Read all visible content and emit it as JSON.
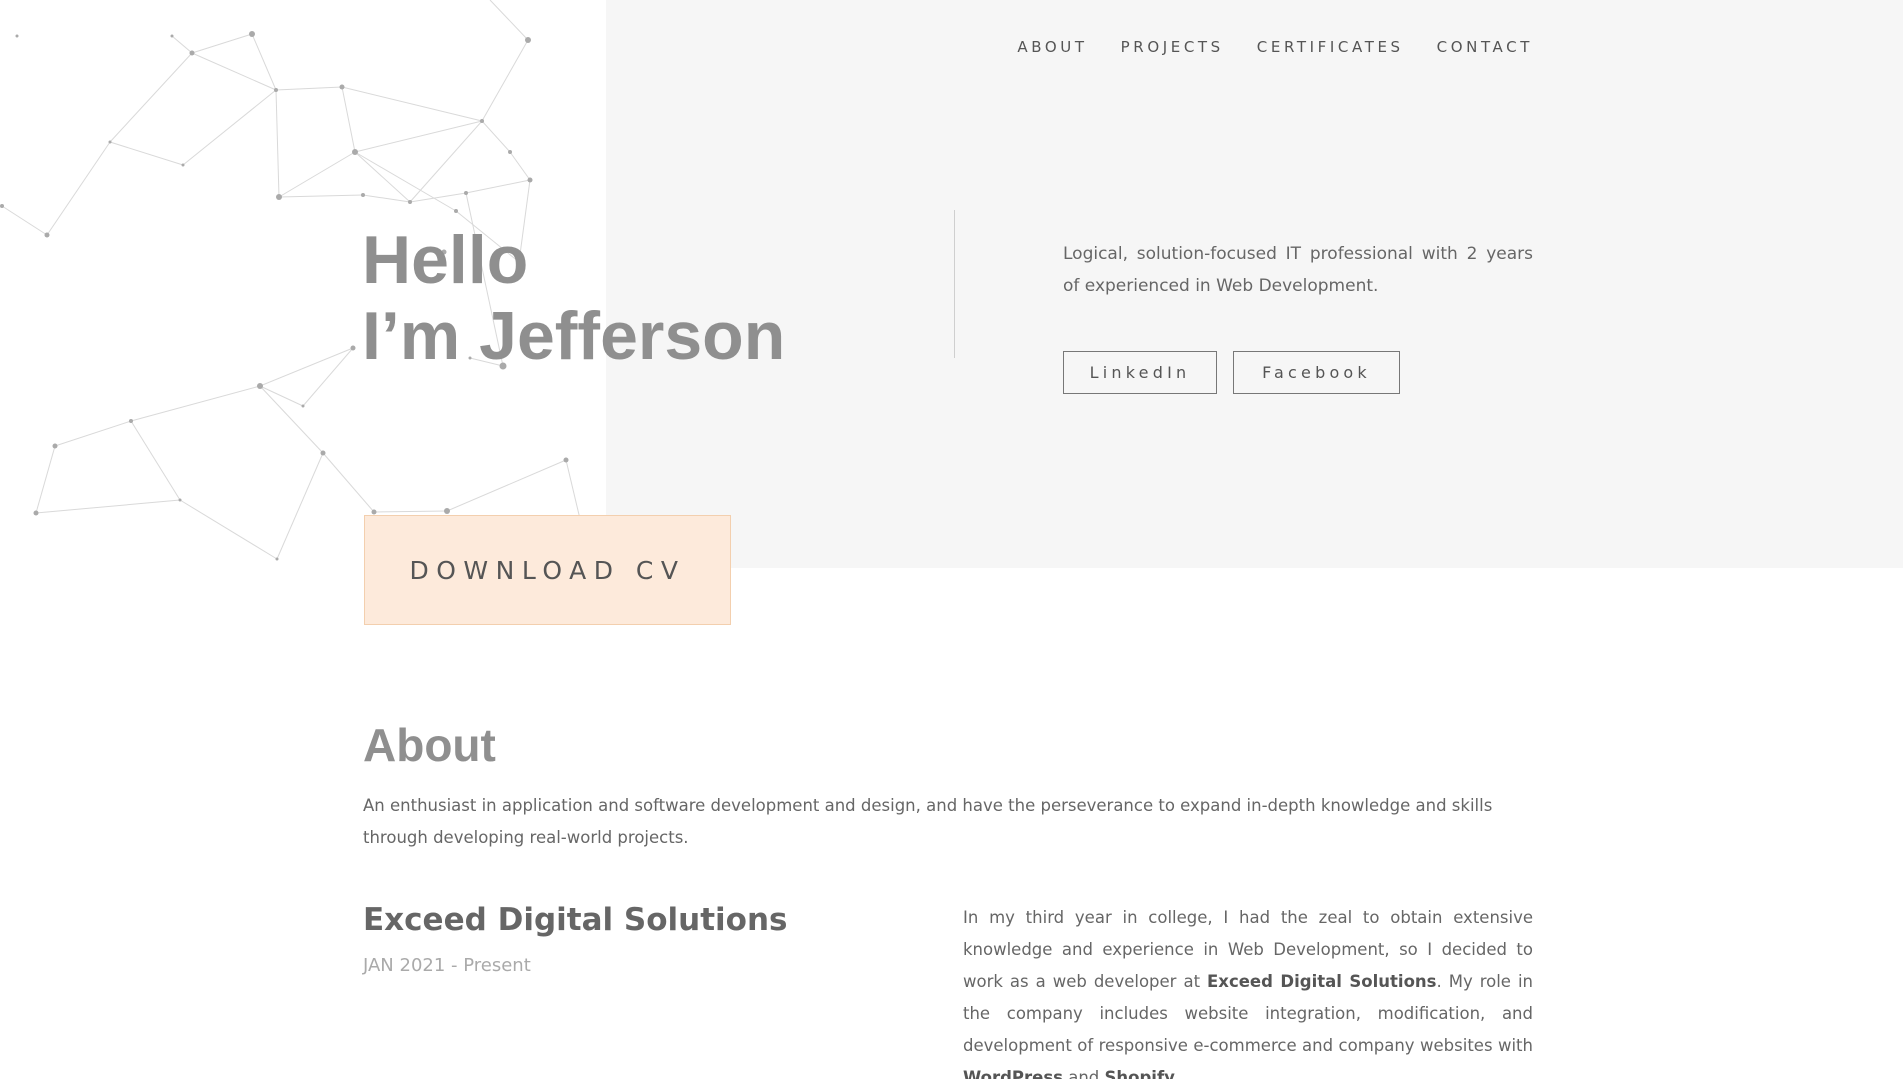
{
  "nav": {
    "items": [
      "ABOUT",
      "PROJECTS",
      "CERTIFICATES",
      "CONTACT"
    ]
  },
  "hero": {
    "greeting_line1": "Hello",
    "greeting_line2": "I’m Jefferson",
    "intro": "Logical, solution-focused IT professional with 2 years of experienced in Web Development.",
    "linkedin_label": "LinkedIn",
    "facebook_label": "Facebook",
    "download_cv_label": "DOWNLOAD CV"
  },
  "about": {
    "title": "About",
    "text": "An enthusiast in application and software development and design, and have the perseverance to expand in-depth knowledge and skills through developing real-world projects."
  },
  "experience": {
    "company": "Exceed Digital Solutions",
    "period": "JAN 2021 - Present",
    "desc_part1": "In my third year in college, I had the zeal to obtain extensive knowledge and experience in Web Development, so I decided to work as a web developer at ",
    "desc_company": "Exceed Digital Solutions",
    "desc_part2": ". My role in the company includes website integration, modification, and development of responsive e-commerce and company websites with ",
    "desc_tech1": "WordPress",
    "desc_and": " and ",
    "desc_tech2": "Shopify",
    "desc_end": "."
  },
  "colors": {
    "hero_background": "#f6f6f6",
    "cv_button": "#fdeadb",
    "heading": "#8f8f8f",
    "text": "#666666"
  }
}
